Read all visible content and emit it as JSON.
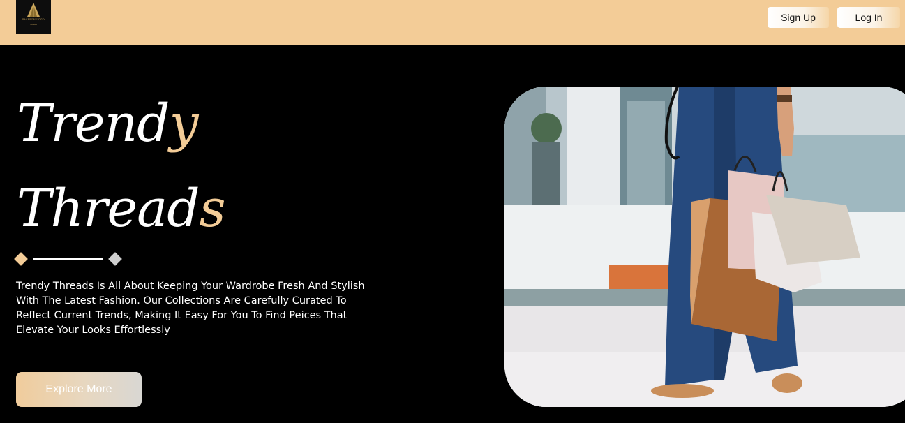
{
  "header": {
    "logo": {
      "text": "FASHION LOGO",
      "sub": "Brand"
    },
    "signup_label": "Sign Up",
    "login_label": "Log In"
  },
  "hero": {
    "title_line1_main": "Trend",
    "title_line1_accent": "y",
    "title_line2_main": "Thread",
    "title_line2_accent": "s",
    "description": "Trendy Threads Is All About Keeping Your Wardrobe Fresh And Stylish With The Latest Fashion. Our Collections Are Carefully Curated To Reflect Current Trends, Making It Easy For You To Find Peices That Elevate Your Looks Effortlessly",
    "explore_label": "Explore More"
  },
  "colors": {
    "header_bg": "#f3cc97",
    "accent": "#f3cc97",
    "page_bg": "#000000"
  }
}
